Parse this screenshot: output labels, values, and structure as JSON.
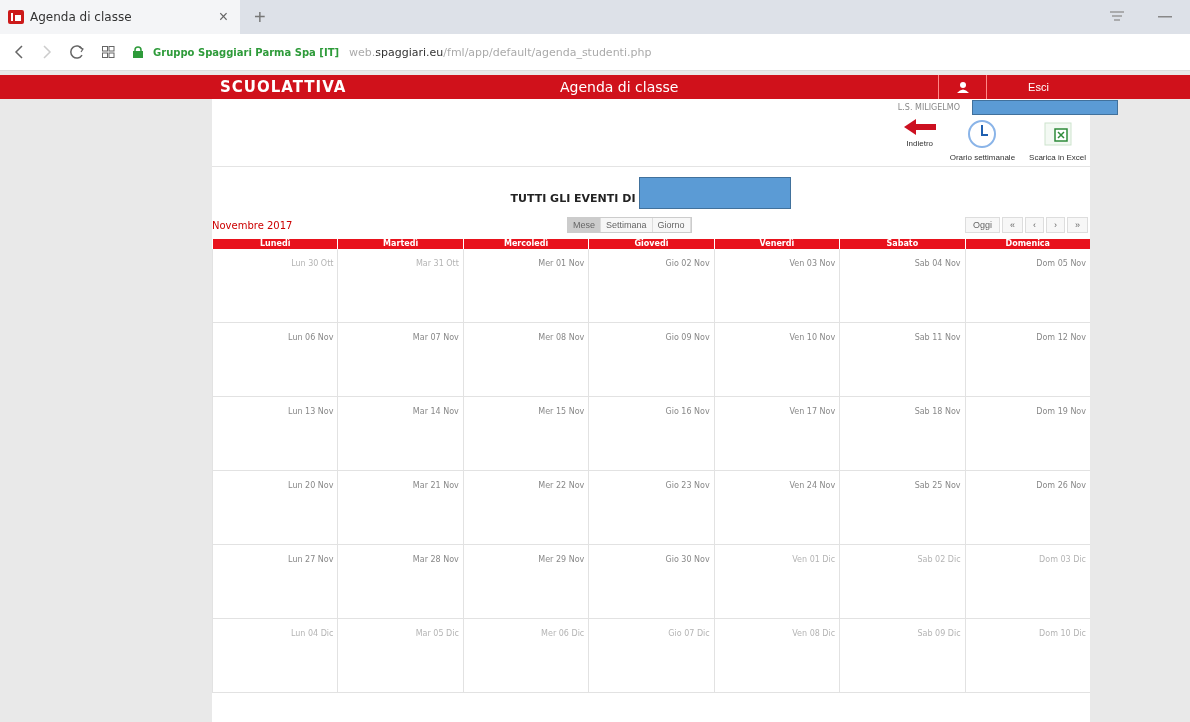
{
  "browser": {
    "tab_title": "Agenda di classe",
    "tab_close": "×",
    "new_tab": "+",
    "url_owner": "Gruppo Spaggiari Parma Spa [IT]",
    "url_prefix": "web.",
    "url_domain": "spaggiari.eu",
    "url_path": "/fml/app/default/agenda_studenti.php"
  },
  "header": {
    "logo": "SCUOLATTIVA",
    "title": "Agenda di classe",
    "exit": "Esci",
    "school": "L.S. MILIGELMO"
  },
  "actions": [
    {
      "kind": "back",
      "label": "Indietro"
    },
    {
      "kind": "schedule",
      "label": "Orario settimanale"
    },
    {
      "kind": "excel",
      "label": "Scarica in Excel"
    }
  ],
  "heading": "TUTTI GLI EVENTI DI",
  "month": "Novembre 2017",
  "views": [
    {
      "label": "Mese",
      "selected": true
    },
    {
      "label": "Settimana",
      "selected": false
    },
    {
      "label": "Giorno",
      "selected": false
    }
  ],
  "nav": [
    "Oggi",
    "«",
    "‹",
    "›",
    "»"
  ],
  "weekdays": [
    "Lunedì",
    "Martedì",
    "Mercoledì",
    "Giovedì",
    "Venerdì",
    "Sabato",
    "Domenica"
  ],
  "weeks": [
    [
      {
        "label": "Lun 30 Ott",
        "other_month": true
      },
      {
        "label": "Mar 31 Ott",
        "other_month": true
      },
      {
        "label": "Mer 01 Nov",
        "other_month": false
      },
      {
        "label": "Gio 02 Nov",
        "other_month": false
      },
      {
        "label": "Ven 03 Nov",
        "other_month": false
      },
      {
        "label": "Sab 04 Nov",
        "other_month": false
      },
      {
        "label": "Dom 05 Nov",
        "other_month": false
      }
    ],
    [
      {
        "label": "Lun 06 Nov",
        "other_month": false
      },
      {
        "label": "Mar 07 Nov",
        "other_month": false
      },
      {
        "label": "Mer 08 Nov",
        "other_month": false
      },
      {
        "label": "Gio 09 Nov",
        "other_month": false
      },
      {
        "label": "Ven 10 Nov",
        "other_month": false
      },
      {
        "label": "Sab 11 Nov",
        "other_month": false
      },
      {
        "label": "Dom 12 Nov",
        "other_month": false
      }
    ],
    [
      {
        "label": "Lun 13 Nov",
        "other_month": false
      },
      {
        "label": "Mar 14 Nov",
        "other_month": false
      },
      {
        "label": "Mer 15 Nov",
        "other_month": false
      },
      {
        "label": "Gio 16 Nov",
        "other_month": false
      },
      {
        "label": "Ven 17 Nov",
        "other_month": false
      },
      {
        "label": "Sab 18 Nov",
        "other_month": false
      },
      {
        "label": "Dom 19 Nov",
        "other_month": false
      }
    ],
    [
      {
        "label": "Lun 20 Nov",
        "other_month": false
      },
      {
        "label": "Mar 21 Nov",
        "other_month": false
      },
      {
        "label": "Mer 22 Nov",
        "other_month": false
      },
      {
        "label": "Gio 23 Nov",
        "other_month": false
      },
      {
        "label": "Ven 24 Nov",
        "other_month": false
      },
      {
        "label": "Sab 25 Nov",
        "other_month": false
      },
      {
        "label": "Dom 26 Nov",
        "other_month": false
      }
    ],
    [
      {
        "label": "Lun 27 Nov",
        "other_month": false
      },
      {
        "label": "Mar 28 Nov",
        "other_month": false
      },
      {
        "label": "Mer 29 Nov",
        "other_month": false
      },
      {
        "label": "Gio 30 Nov",
        "other_month": false
      },
      {
        "label": "Ven 01 Dic",
        "other_month": true
      },
      {
        "label": "Sab 02 Dic",
        "other_month": true
      },
      {
        "label": "Dom 03 Dic",
        "other_month": true
      }
    ],
    [
      {
        "label": "Lun 04 Dic",
        "other_month": true
      },
      {
        "label": "Mar 05 Dic",
        "other_month": true
      },
      {
        "label": "Mer 06 Dic",
        "other_month": true
      },
      {
        "label": "Gio 07 Dic",
        "other_month": true
      },
      {
        "label": "Ven 08 Dic",
        "other_month": true
      },
      {
        "label": "Sab 09 Dic",
        "other_month": true
      },
      {
        "label": "Dom 10 Dic",
        "other_month": true
      }
    ]
  ]
}
